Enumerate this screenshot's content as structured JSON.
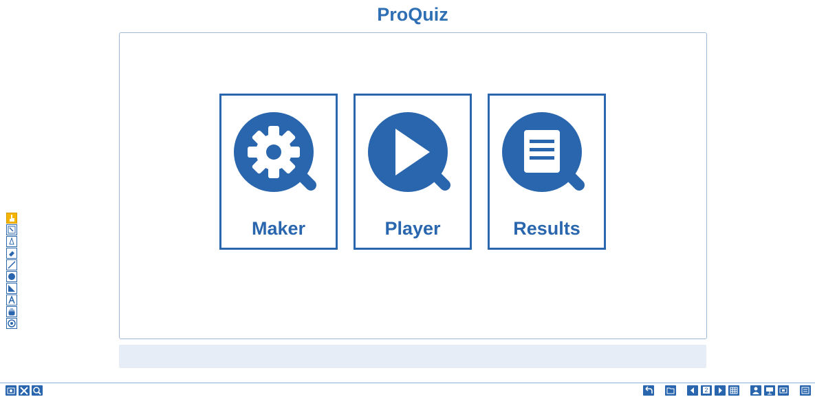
{
  "app": {
    "title": "ProQuiz"
  },
  "cards": [
    {
      "label": "Maker",
      "icon": "gear-icon"
    },
    {
      "label": "Player",
      "icon": "play-icon"
    },
    {
      "label": "Results",
      "icon": "document-icon"
    }
  ],
  "colors": {
    "accent": "#2a66ad",
    "title": "#2f6fb4",
    "status_bar": "#e6edf7",
    "active_tool": "#f5b400"
  },
  "left_toolbar": [
    {
      "icon": "pointer-hand-icon",
      "active": true
    },
    {
      "icon": "select-icon"
    },
    {
      "icon": "pen-icon"
    },
    {
      "icon": "eraser-icon"
    },
    {
      "icon": "line-icon"
    },
    {
      "icon": "circle-icon"
    },
    {
      "icon": "ruler-icon"
    },
    {
      "icon": "text-icon"
    },
    {
      "icon": "hand-icon"
    },
    {
      "icon": "target-icon"
    }
  ],
  "bottom_left": [
    "camera-icon",
    "tools-icon",
    "zoom-icon"
  ],
  "bottom_right": {
    "page_number": "2",
    "icons": [
      "undo-icon",
      "folder-icon",
      "prev-page-icon",
      "page-indicator",
      "next-page-icon",
      "grid-icon",
      "user-icon",
      "presentation-icon",
      "screen-icon",
      "window-icon"
    ]
  }
}
